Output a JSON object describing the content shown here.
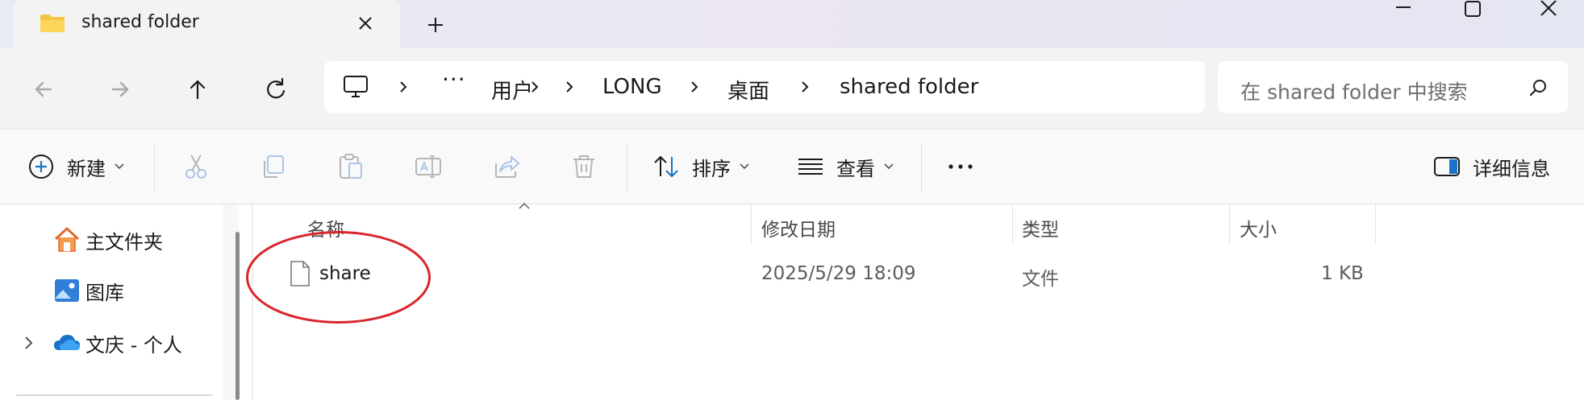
{
  "tab": {
    "title": "shared folder"
  },
  "breadcrumb": {
    "overflow": "···",
    "items": [
      "用户",
      "LONG",
      "桌面",
      "shared folder"
    ]
  },
  "search": {
    "placeholder": "在 shared folder 中搜索"
  },
  "commands": {
    "new": "新建",
    "sort": "排序",
    "view": "查看",
    "details": "详细信息"
  },
  "nav": {
    "items": [
      {
        "label": "主文件夹",
        "icon": "home-icon"
      },
      {
        "label": "图库",
        "icon": "gallery-icon"
      },
      {
        "label": "文庆 - 个人",
        "icon": "onedrive-cloud-icon"
      }
    ]
  },
  "columns": {
    "name": "名称",
    "modified": "修改日期",
    "type": "类型",
    "size": "大小"
  },
  "files": [
    {
      "name": "share",
      "modified": "2025/5/29 18:09",
      "type": "文件",
      "size": "1 KB"
    }
  ],
  "colors": {
    "annotation": "#d9262c",
    "accent_blue": "#1a73c6",
    "folder_yellow": "#f4c542"
  }
}
